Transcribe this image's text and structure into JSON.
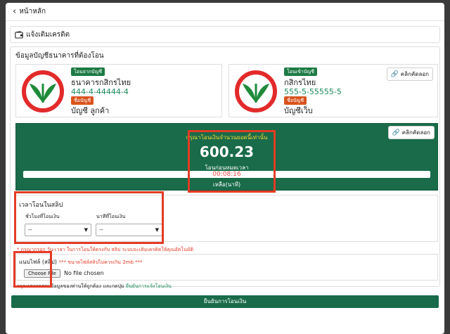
{
  "topbar": {
    "back_label": "หน้าหลัก"
  },
  "credit": {
    "title": "แจ้งเติมเครดิต"
  },
  "section_title": "ข้อมูลบัญชีธนาคารที่ต้องโอน",
  "from_account": {
    "badge": "โอนจากบัญชี",
    "bank_name": "ธนาคารกสิกรไทย",
    "number": "444-4-44444-4",
    "name_badge": "ชื่อบัญชี",
    "owner": "บัญชี ลูกค้า"
  },
  "to_account": {
    "badge": "โอนเข้าบัญชี",
    "bank_name": "กสิกรไทย",
    "number": "555-5-55555-5",
    "name_badge": "ชื่อบัญชี",
    "owner": "บัญชีเว็บ",
    "copy_label": "คลิกคัดลอก"
  },
  "amount": {
    "copy_label": "คลิกคัดลอก",
    "label": "กรุณาโอนเงินจำนวนยอดนี้เท่านั้น",
    "value": "600.23",
    "timer_label": "โอนก่อนหมดเวลา",
    "timer": "00:08:16",
    "remaining_label": "เหลือ(นาที)"
  },
  "slip_time": {
    "title": "เวลาโอนในสลิป",
    "hour_label": "ชั่วโมงที่โอนเงิน",
    "minute_label": "นาทีที่โอนเงิน",
    "hour_value": "--",
    "minute_value": "--"
  },
  "warning": "* กรุณากรอก วัน-เวลา ในการโอนให้ตรงกับ สลิป ระบบจะเติมเครดิตให้คุณอัตโนมัติ",
  "upload": {
    "title": "แนบไฟล์ (สลิป)",
    "note": "*** ขนาดไฟล์สลิปไม่ควรเกิน 2mb ***",
    "button": "Choose File",
    "status": "No file chosen"
  },
  "check_note": {
    "text": "กรุณาตรวจสอบข้อมูลของท่านให้ถูกต้อง และกดปุ่ม",
    "link": "ยืนยันการแจ้งโอนเงิน"
  },
  "confirm": {
    "label": "ยืนยันการโอนเงิน"
  },
  "colors": {
    "primary": "#196b49",
    "accent_yellow": "#f7d531",
    "highlight_red": "#e33b26",
    "account_green": "#1a8a5c"
  }
}
